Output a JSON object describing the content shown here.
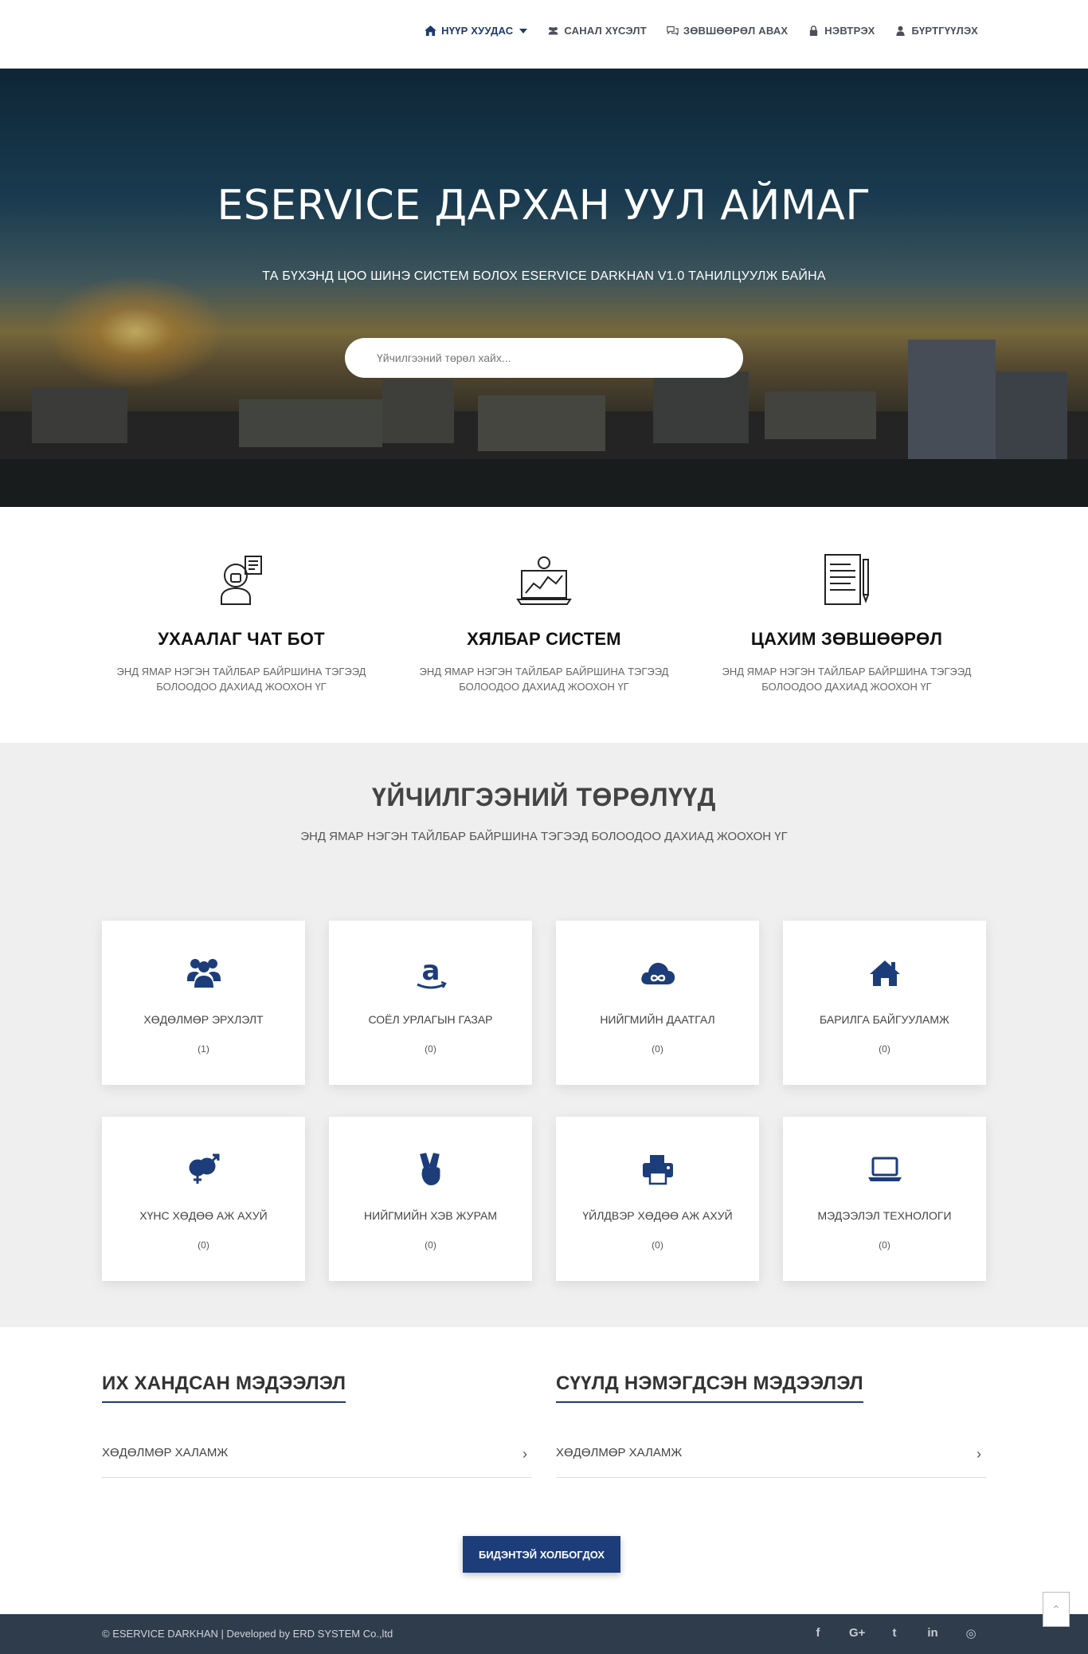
{
  "nav": {
    "items": [
      {
        "label": "НҮҮР ХУУДАС",
        "icon": "home-icon",
        "active": true
      },
      {
        "label": "САНАЛ ХҮСЭЛТ",
        "icon": "users-icon"
      },
      {
        "label": "ЗӨВШӨӨРӨЛ АВАХ",
        "icon": "comments-icon"
      },
      {
        "label": "НЭВТРЭХ",
        "icon": "lock-icon"
      },
      {
        "label": "БҮРТГҮҮЛЭХ",
        "icon": "user-icon"
      }
    ]
  },
  "hero": {
    "title": "ESERVICE ДАРХАН УУЛ АЙМАГ",
    "subtitle": "ТА БҮХЭНД ЦОО ШИНЭ СИСТЕМ БОЛОХ ESERVICE DARKHAN V1.0 ТАНИЛЦУУЛЖ БАЙНА",
    "search_placeholder": "Үйчилгээний төрөл хайх..."
  },
  "features": [
    {
      "title": "УХААЛАГ ЧАТ БОТ",
      "desc_line1": "ЭНД ЯМАР НЭГЭН ТАЙЛБАР БАЙРШИНА ТЭГЭЭД",
      "desc_line2": "БОЛООДОО ДАХИАД ЖООХОН ҮГ",
      "icon": "chat-bot-icon"
    },
    {
      "title": "ХЯЛБАР СИСТЕМ",
      "desc_line1": "ЭНД ЯМАР НЭГЭН ТАЙЛБАР БАЙРШИНА ТЭГЭЭД",
      "desc_line2": "БОЛООДОО ДАХИАД ЖООХОН ҮГ",
      "icon": "laptop-chart-icon"
    },
    {
      "title": "ЦАХИМ ЗӨВШӨӨРӨЛ",
      "desc_line1": "ЭНД ЯМАР НЭГЭН ТАЙЛБАР БАЙРШИНА ТЭГЭЭД",
      "desc_line2": "БОЛООДОО ДАХИАД ЖООХОН ҮГ",
      "icon": "document-pen-icon"
    }
  ],
  "services": {
    "title": "ҮЙЧИЛГЭЭНИЙ ТӨРӨЛҮҮД",
    "subtitle": "ЭНД ЯМАР НЭГЭН ТАЙЛБАР БАЙРШИНА ТЭГЭЭД БОЛООДОО ДАХИАД ЖООХОН ҮГ",
    "cards": [
      {
        "label": "ХӨДӨЛМӨР ЭРХЛЭЛТ",
        "count": "(1)",
        "icon": "users-icon"
      },
      {
        "label": "СОЁЛ УРЛАГЫН ГАЗАР",
        "count": "(0)",
        "icon": "amazon-icon"
      },
      {
        "label": "НИЙГМИЙН ДААТГАЛ",
        "count": "(0)",
        "icon": "cloud-infinity-icon"
      },
      {
        "label": "БАРИЛГА БАЙГУУЛАМЖ",
        "count": "(0)",
        "icon": "home-icon"
      },
      {
        "label": "ХҮНС ХӨДӨӨ АЖ АХУЙ",
        "count": "(0)",
        "icon": "gender-icon"
      },
      {
        "label": "НИЙГМИЙН ХЭВ ЖУРАМ",
        "count": "(0)",
        "icon": "peace-hand-icon"
      },
      {
        "label": "ҮЙЛДВЭР ХӨДӨӨ АЖ АХУЙ",
        "count": "(0)",
        "icon": "printer-icon"
      },
      {
        "label": "МЭДЭЭЛЭЛ ТЕХНОЛОГИ",
        "count": "(0)",
        "icon": "laptop-icon"
      }
    ]
  },
  "popular": {
    "title": "ИХ ХАНДСАН МЭДЭЭЛЭЛ",
    "items": [
      {
        "label": "ХӨДӨЛМӨР ХАЛАМЖ"
      }
    ]
  },
  "recent": {
    "title": "СҮҮЛД НЭМЭГДСЭН МЭДЭЭЛЭЛ",
    "items": [
      {
        "label": "ХӨДӨЛМӨР ХАЛАМЖ"
      }
    ]
  },
  "contact": {
    "label": "БИДЭНТЭЙ ХОЛБОГДОХ"
  },
  "footer": {
    "copyright": "© ESERVICE DARKHAN | Developed by ERD SYSTEM Co.,ltd",
    "social": [
      {
        "name": "facebook-icon",
        "glyph": "f"
      },
      {
        "name": "google-plus-icon",
        "glyph": "G+"
      },
      {
        "name": "twitter-icon",
        "glyph": "t"
      },
      {
        "name": "linkedin-icon",
        "glyph": "in"
      },
      {
        "name": "instagram-icon",
        "glyph": "◎"
      }
    ]
  },
  "colors": {
    "brand": "#1d3d7a",
    "footer": "#2f3c4c",
    "section_bg": "#efefef"
  }
}
